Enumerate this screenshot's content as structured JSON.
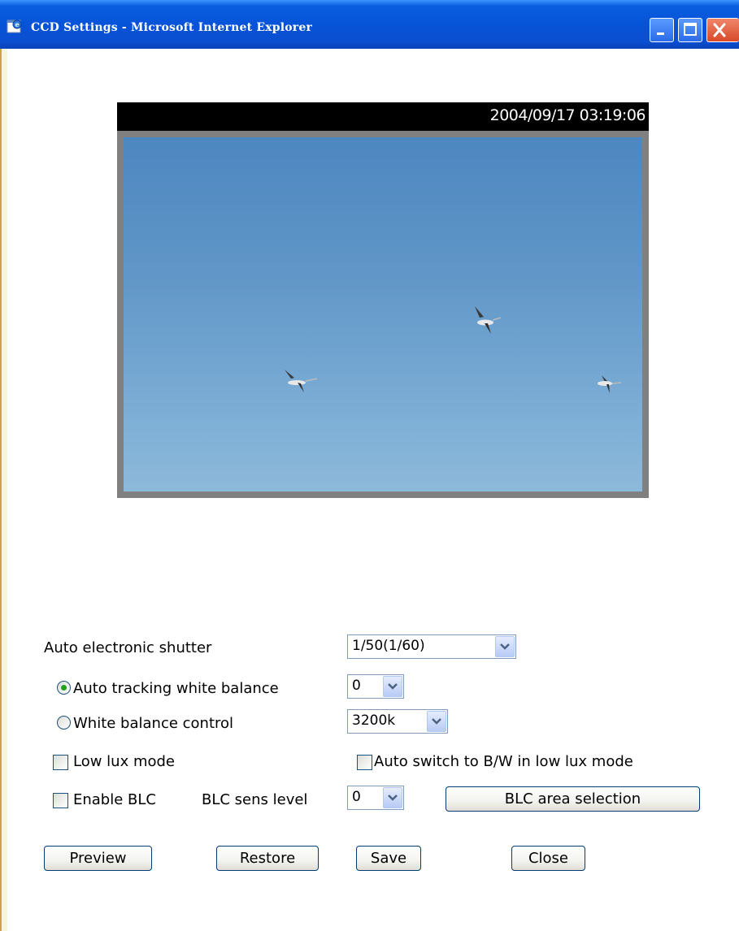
{
  "window": {
    "title": "CCD Settings - Microsoft Internet Explorer"
  },
  "camera": {
    "timestamp": "2004/09/17 03:19:06"
  },
  "form": {
    "shutter": {
      "label": "Auto electronic shutter",
      "value": "1/50(1/60)"
    },
    "auto_wb": {
      "label": "Auto tracking white balance",
      "value": "0",
      "selected": true
    },
    "wb_control": {
      "label": "White balance control",
      "value": "3200k",
      "selected": false
    },
    "low_lux": {
      "label": "Low lux mode",
      "checked": false
    },
    "auto_bw": {
      "label": "Auto switch to B/W in low lux mode",
      "checked": false
    },
    "blc": {
      "label": "Enable BLC",
      "checked": false
    },
    "blc_sens": {
      "label": "BLC sens level",
      "value": "0"
    },
    "blc_area_button": "BLC area selection"
  },
  "buttons": {
    "preview": "Preview",
    "restore": "Restore",
    "save": "Save",
    "close": "Close"
  },
  "icons": {
    "title_icon": "ie-icon",
    "minimize": "minimize-icon",
    "maximize": "maximize-icon",
    "close": "close-icon",
    "dropdown": "chevron-down-icon"
  }
}
